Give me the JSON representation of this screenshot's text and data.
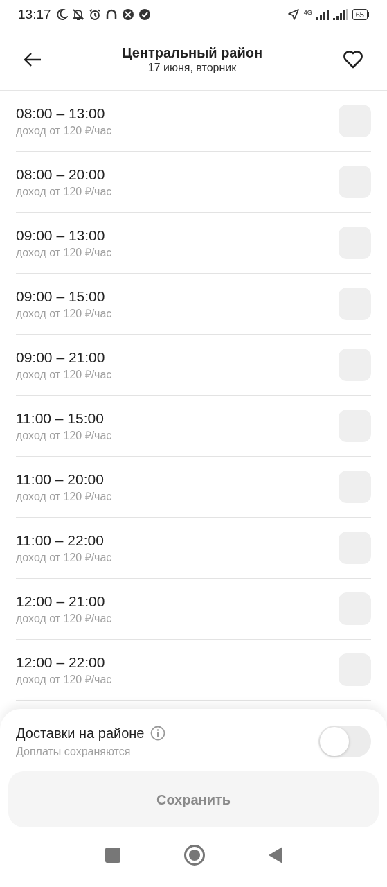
{
  "status_bar": {
    "time": "13:17",
    "network": "4G",
    "battery": "65"
  },
  "header": {
    "title": "Центральный район",
    "subtitle": "17 июня, вторник"
  },
  "slots": [
    {
      "time": "08:00 – 13:00",
      "income": "доход от 120 ₽/час",
      "checked": false
    },
    {
      "time": "08:00 – 20:00",
      "income": "доход от 120 ₽/час",
      "checked": false
    },
    {
      "time": "09:00 – 13:00",
      "income": "доход от 120 ₽/час",
      "checked": false
    },
    {
      "time": "09:00 – 15:00",
      "income": "доход от 120 ₽/час",
      "checked": false
    },
    {
      "time": "09:00 – 21:00",
      "income": "доход от 120 ₽/час",
      "checked": false
    },
    {
      "time": "11:00 – 15:00",
      "income": "доход от 120 ₽/час",
      "checked": false
    },
    {
      "time": "11:00 – 20:00",
      "income": "доход от 120 ₽/час",
      "checked": false
    },
    {
      "time": "11:00 – 22:00",
      "income": "доход от 120 ₽/час",
      "checked": false
    },
    {
      "time": "12:00 – 21:00",
      "income": "доход от 120 ₽/час",
      "checked": false
    },
    {
      "time": "12:00 – 22:00",
      "income": "доход от 120 ₽/час",
      "checked": false
    }
  ],
  "district_delivery": {
    "label": "Доставки на районе",
    "note": "Доплаты сохраняются",
    "on": false
  },
  "save_button": {
    "label": "Сохранить",
    "disabled": true
  }
}
